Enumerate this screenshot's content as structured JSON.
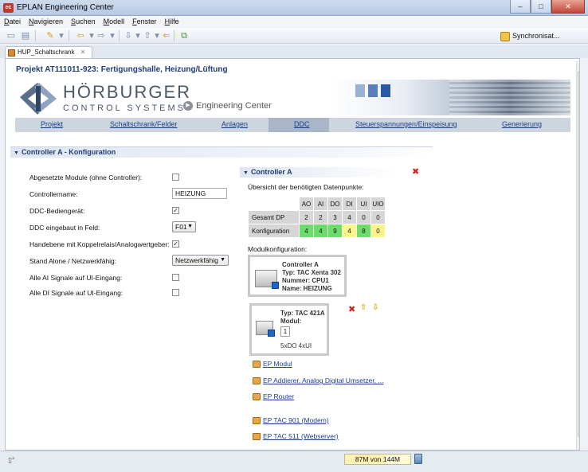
{
  "window": {
    "title": "EPLAN Engineering Center",
    "app_icon_text": "ec",
    "minimize": "–",
    "maximize": "□",
    "close": "✕"
  },
  "menu": [
    {
      "u": "D",
      "rest": "atei"
    },
    {
      "u": "N",
      "rest": "avigieren"
    },
    {
      "u": "S",
      "rest": "uchen"
    },
    {
      "u": "M",
      "rest": "odell"
    },
    {
      "u": "F",
      "rest": "enster"
    },
    {
      "u": "H",
      "rest": "ilfe"
    }
  ],
  "toolbar": {
    "sync_label": "Synchronisat..."
  },
  "editor_tab": {
    "label": "HUP_Schaltschrank",
    "close": "✕"
  },
  "project_title": "Projekt AT111011-923: Fertigungshalle, Heizung/Lüftung",
  "logo": {
    "line1": "HÖRBURGER",
    "line2": "CONTROL SYSTEMS"
  },
  "engineering_center": "Engineering Center",
  "nav": [
    "Projekt",
    "Schaltschrank/Felder",
    "Anlagen",
    "DDC",
    "Steuerspannungen/Einspeisung",
    "Generierung"
  ],
  "nav_active": "DDC",
  "section": {
    "title": "Controller A - Konfiguration"
  },
  "form": {
    "abgesetzte_label": "Abgesetzte Module (ohne Controller):",
    "abgesetzte_checked": false,
    "controllername_label": "Controllername:",
    "controllername_value": "HEIZUNG",
    "ddc_bedien_label": "DDC-Bediengerät:",
    "ddc_bedien_checked": true,
    "ddc_feld_label": "DDC eingebaut in Feld:",
    "ddc_feld_value": "F01",
    "handebene_label": "Handebene mit Koppelrelais/Analogwertgeber:",
    "handebene_checked": true,
    "standalone_label": "Stand Alone / Netzwerkfähig:",
    "standalone_value": "Netzwerkfähig",
    "ai_label": "Alle AI Signale auf UI-Eingang:",
    "ai_checked": false,
    "di_label": "Alle DI Signale auf UI-Eingang:",
    "di_checked": false
  },
  "controller": {
    "title": "Controller A",
    "uebersicht": "Übersicht der benötigten Datenpunkte:",
    "columns": [
      "AO",
      "AI",
      "DO",
      "DI",
      "UI",
      "UIO"
    ],
    "rows": [
      {
        "label": "Gesamt DP",
        "values": [
          "2",
          "2",
          "3",
          "4",
          "0",
          "0"
        ],
        "colors": [
          "g",
          "g",
          "g",
          "g",
          "g",
          "g"
        ]
      },
      {
        "label": "Konfiguration",
        "values": [
          "4",
          "4",
          "9",
          "4",
          "8",
          "0"
        ],
        "colors": [
          "gn",
          "gn",
          "gn",
          "ye",
          "gn",
          "ye"
        ]
      }
    ],
    "modulkonfiguration": "Modulkonfiguration:",
    "main_module": {
      "name": "Controller A",
      "typ": "Typ: TAC Xenta 302",
      "nummer": "Nummer: CPU1",
      "name_line": "Name: HEIZUNG"
    },
    "io_module": {
      "typ": "Typ: TAC 421A",
      "modul": "Modul:",
      "modul_nr": "1",
      "io": "5xDO 4xUI"
    },
    "links": [
      "EP Modul",
      "EP Addierer, Analog Digital Umsetzer, ...",
      "EP Router",
      "EP TAC 901 (Modem)",
      "EP TAC 511 (Webserver)"
    ]
  },
  "status": {
    "memory": "87M von 144M",
    "memory_fraction": 0.604
  },
  "colors": {
    "accent": "#1f3c7a",
    "link": "#1a3e8c",
    "green": "#6cdc6c",
    "yellow": "#fbf58a",
    "grey": "#d6d6d6"
  }
}
